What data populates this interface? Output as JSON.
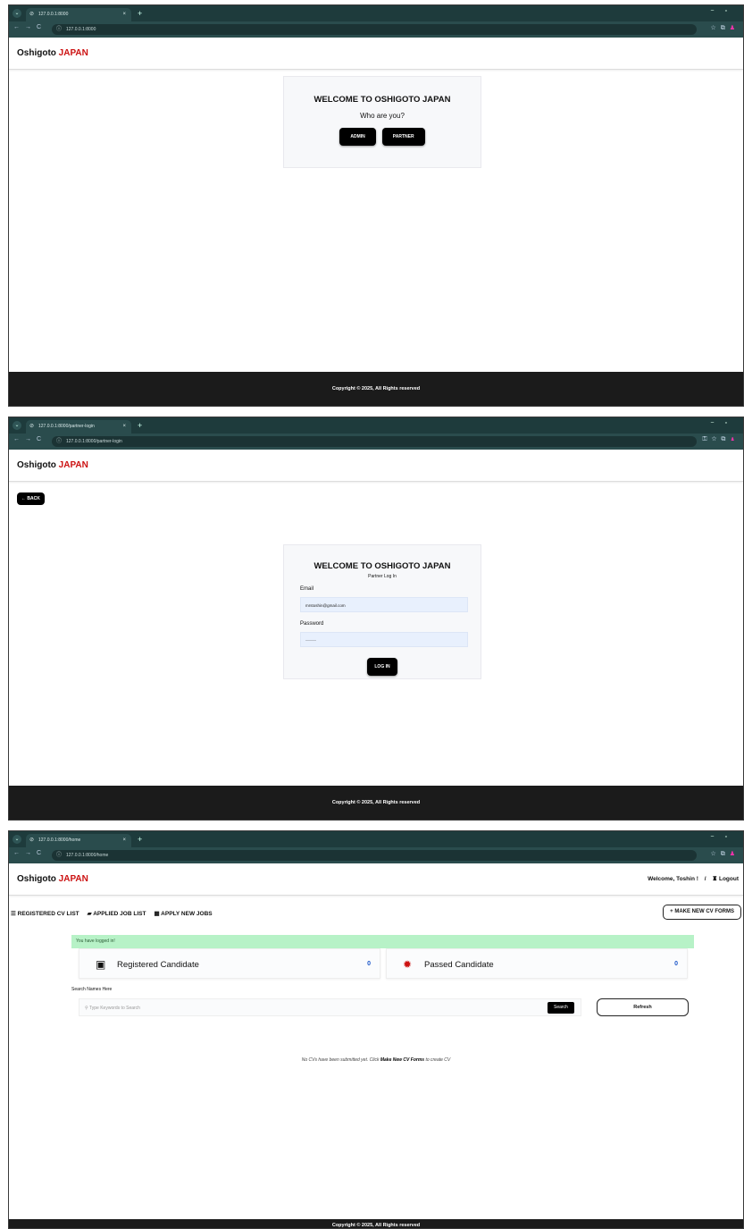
{
  "shot1": {
    "tab": {
      "title": "127.0.0.1:8000",
      "close": "×"
    },
    "new_tab": "+",
    "address": "127.0.0.1:8000",
    "brand": {
      "name": "Oshigoto",
      "accent": "JAPAN"
    },
    "card": {
      "title": "WELCOME TO OSHIGOTO JAPAN",
      "subtitle": "Who are you?",
      "admin_label": "ADMIN",
      "partner_label": "PARTNER"
    },
    "footer": "Copyright © 2025, All Rights reserved"
  },
  "shot2": {
    "tab": {
      "title": "127.0.0.1:8000/partner-login",
      "close": "×"
    },
    "new_tab": "+",
    "address": "127.0.0.1:8000/partner-login",
    "brand": {
      "name": "Oshigoto",
      "accent": "JAPAN"
    },
    "back_label": "← BACK",
    "card": {
      "title": "WELCOME TO OSHIGOTO JAPAN",
      "subtitle": "Partner Log In",
      "email_label": "Email",
      "email_value": "mrstoshin@gmail.com",
      "password_label": "Password",
      "password_value": "············",
      "login_label": "LOG IN"
    },
    "footer": "Copyright © 2025, All Rights reserved"
  },
  "shot3": {
    "tab": {
      "title": "127.0.0.1:8000/home",
      "close": "×"
    },
    "new_tab": "+",
    "address": "127.0.0.1:8000/home",
    "brand": {
      "name": "Oshigoto",
      "accent": "JAPAN"
    },
    "welcome": "Welcome, Toshin !",
    "separator": "/",
    "logout_label": "Logout",
    "menu": [
      {
        "icon": "☰",
        "label": "REGISTERED CV LIST"
      },
      {
        "icon": "▰",
        "label": "APPLIED JOB LIST"
      },
      {
        "icon": "▦",
        "label": "APPLY NEW JOBS"
      }
    ],
    "make_cv_label": "+ MAKE NEW CV FORMS",
    "alert": "You have logged in!",
    "stats": [
      {
        "label": "Registered Candidate",
        "value": "0"
      },
      {
        "label": "Passed Candidate",
        "value": "0"
      }
    ],
    "search_label": "Search Names Here",
    "search_placeholder": "Type Keywords to Search",
    "search_button": "Search",
    "refresh_button": "Refresh",
    "empty": {
      "prefix": "No CVs have been submitted yet. Click",
      "link": "Make New CV Forms",
      "suffix": "to create CV"
    },
    "footer": "Copyright © 2025, All Rights reserved"
  },
  "colors": {
    "brand_accent": "#cc1111",
    "chrome": "#1e3b3c",
    "footer": "#1b1b1b",
    "alert": "#b7f2c7",
    "stat_number": "#1a56c9"
  }
}
